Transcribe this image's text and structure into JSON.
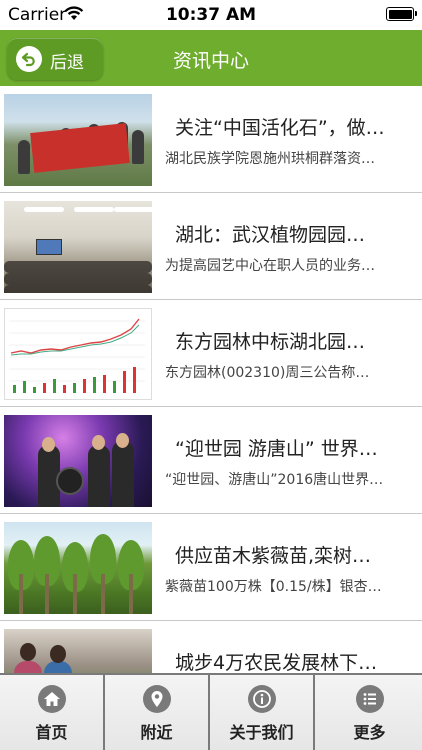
{
  "status_bar": {
    "carrier": "Carrier",
    "time": "10:37 AM"
  },
  "nav": {
    "back_label": "后退",
    "title": "资讯中心",
    "accent_color": "#6fad2f"
  },
  "news": [
    {
      "title": "关注“中国活化石”，做…",
      "summary": "湖北民族学院恩施州珙桐群落资…"
    },
    {
      "title": "湖北：武汉植物园园…",
      "summary": "为提高园艺中心在职人员的业务…"
    },
    {
      "title": "东方园林中标湖北园…",
      "summary": "东方园林(002310)周三公告称…"
    },
    {
      "title": "“迎世园 游唐山” 世界…",
      "summary": "“迎世园、游唐山”2016唐山世界…"
    },
    {
      "title": "供应苗木紫薇苗,栾树…",
      "summary": "紫薇苗100万株【0.15/株】银杏…"
    },
    {
      "title": "城步4万农民发展林下…",
      "summary": ""
    }
  ],
  "tabs": [
    {
      "label": "首页",
      "icon": "home-icon"
    },
    {
      "label": "附近",
      "icon": "location-pin-icon"
    },
    {
      "label": "关于我们",
      "icon": "info-icon"
    },
    {
      "label": "更多",
      "icon": "more-list-icon"
    }
  ]
}
